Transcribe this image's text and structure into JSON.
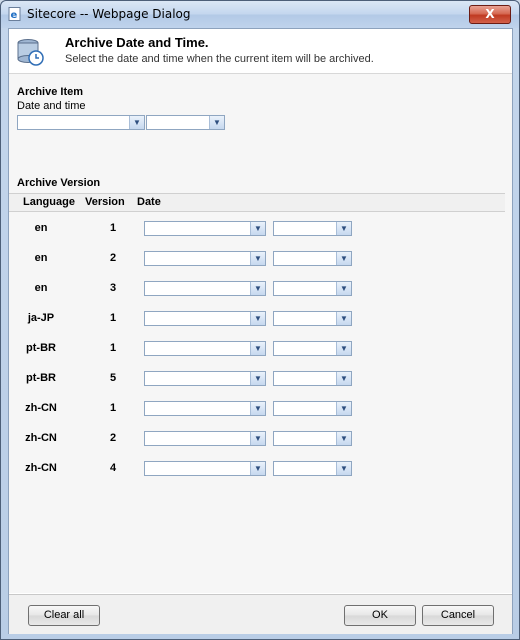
{
  "window": {
    "title": "Sitecore -- Webpage Dialog",
    "close_label": "X"
  },
  "header": {
    "title": "Archive Date and Time.",
    "subtitle": "Select the date and time when the current item will be archived."
  },
  "archive_item": {
    "section_title": "Archive Item",
    "field_label": "Date and time"
  },
  "archive_version": {
    "section_title": "Archive Version",
    "columns": [
      "Language",
      "Version",
      "Date"
    ],
    "rows": [
      {
        "language": "en",
        "version": "1"
      },
      {
        "language": "en",
        "version": "2"
      },
      {
        "language": "en",
        "version": "3"
      },
      {
        "language": "ja-JP",
        "version": "1"
      },
      {
        "language": "pt-BR",
        "version": "1"
      },
      {
        "language": "pt-BR",
        "version": "5"
      },
      {
        "language": "zh-CN",
        "version": "1"
      },
      {
        "language": "zh-CN",
        "version": "2"
      },
      {
        "language": "zh-CN",
        "version": "4"
      }
    ]
  },
  "footer": {
    "clear_all_label": "Clear all",
    "ok_label": "OK",
    "cancel_label": "Cancel"
  },
  "icons": {
    "title_icon": "ie-page-icon",
    "header_icon": "archive-clock-icon",
    "dropdown_icon": "chevron-down-icon"
  },
  "colors": {
    "accent": "#4d5f78",
    "close": "#c03a22"
  }
}
